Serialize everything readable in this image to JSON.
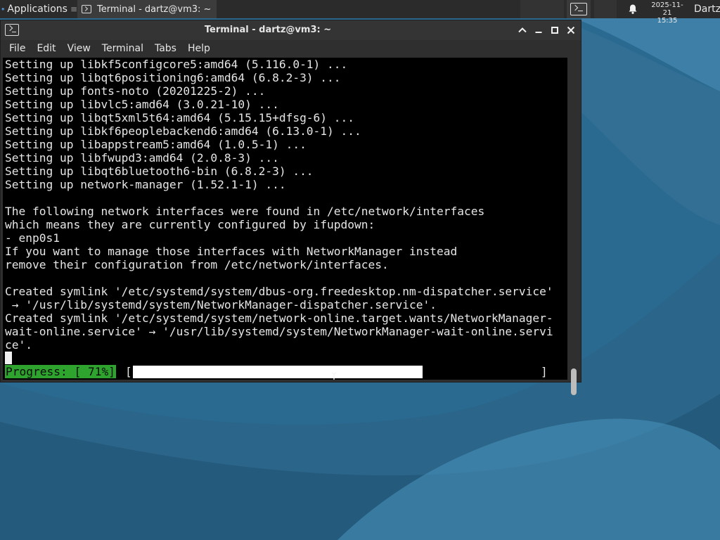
{
  "panel": {
    "applications_label": "Applications",
    "task_label": "Terminal - dartz@vm3: ~",
    "clock_date": "2025-11-21",
    "clock_time": "15:35",
    "user_label": "Dartz"
  },
  "window": {
    "title": "Terminal - dartz@vm3: ~",
    "menu": [
      "File",
      "Edit",
      "View",
      "Terminal",
      "Tabs",
      "Help"
    ]
  },
  "terminal": {
    "lines": [
      "Setting up libkf5configcore5:amd64 (5.116.0-1) ...",
      "Setting up libqt6positioning6:amd64 (6.8.2-3) ...",
      "Setting up fonts-noto (20201225-2) ...",
      "Setting up libvlc5:amd64 (3.0.21-10) ...",
      "Setting up libqt5xml5t64:amd64 (5.15.15+dfsg-6) ...",
      "Setting up libkf6peoplebackend6:amd64 (6.13.0-1) ...",
      "Setting up libappstream5:amd64 (1.0.5-1) ...",
      "Setting up libfwupd3:amd64 (2.0.8-3) ...",
      "Setting up libqt6bluetooth6-bin (6.8.2-3) ...",
      "Setting up network-manager (1.52.1-1) ...",
      "",
      "The following network interfaces were found in /etc/network/interfaces",
      "which means they are currently configured by ifupdown:",
      "- enp0s1",
      "If you want to manage those interfaces with NetworkManager instead",
      "remove their configuration from /etc/network/interfaces.",
      "",
      "Created symlink '/etc/systemd/system/dbus-org.freedesktop.nm-dispatcher.service'",
      " → '/usr/lib/systemd/system/NetworkManager-dispatcher.service'.",
      "Created symlink '/etc/systemd/system/network-online.target.wants/NetworkManager-",
      "wait-online.service' → '/usr/lib/systemd/system/NetworkManager-wait-online.servi",
      "ce'."
    ],
    "progress_label": "Progress: [ 71%]",
    "progress_open": "[",
    "progress_close": "]",
    "progress_fraction": 0.71
  },
  "colors": {
    "progress_label_bg": "#2ea42e",
    "terminal_bg": "#000000",
    "terminal_fg": "#e6e6e6",
    "panel_bg": "#2b2b2b"
  },
  "icons": {
    "apps_menu": "xfce-mouse-logo-icon",
    "task_terminal": "terminal-icon",
    "launcher": "terminal-launcher-icon",
    "notifications": "bell-icon",
    "window_controls": [
      "chevron-up-icon",
      "minimize-icon",
      "maximize-icon",
      "close-icon"
    ]
  }
}
